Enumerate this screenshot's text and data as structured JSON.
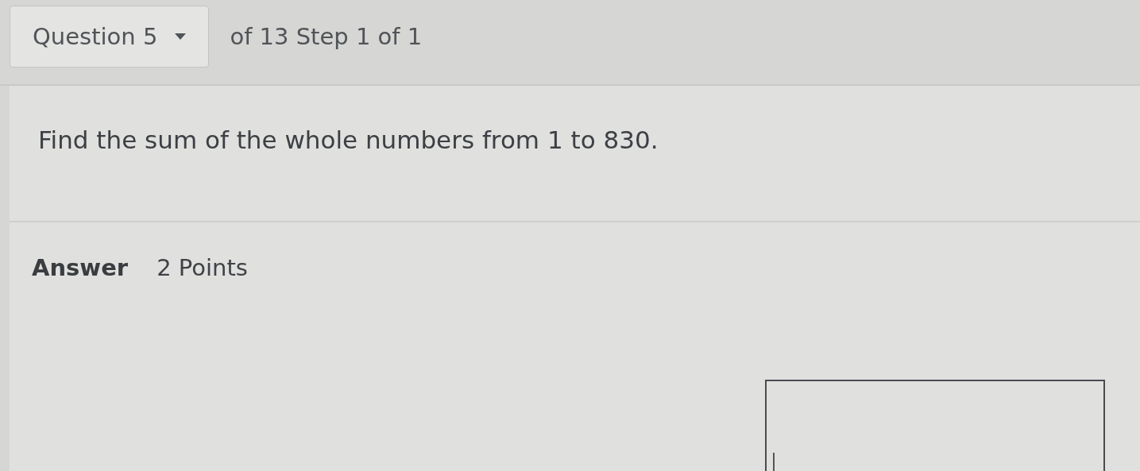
{
  "header": {
    "question_menu": {
      "label": "Question 5"
    },
    "progress": "of 13 Step 1 of 1"
  },
  "question": {
    "text": "Find the sum of the whole numbers from 1 to 830."
  },
  "answer": {
    "heading": "Answer",
    "points": "2 Points",
    "field": {
      "focused": true
    }
  }
}
